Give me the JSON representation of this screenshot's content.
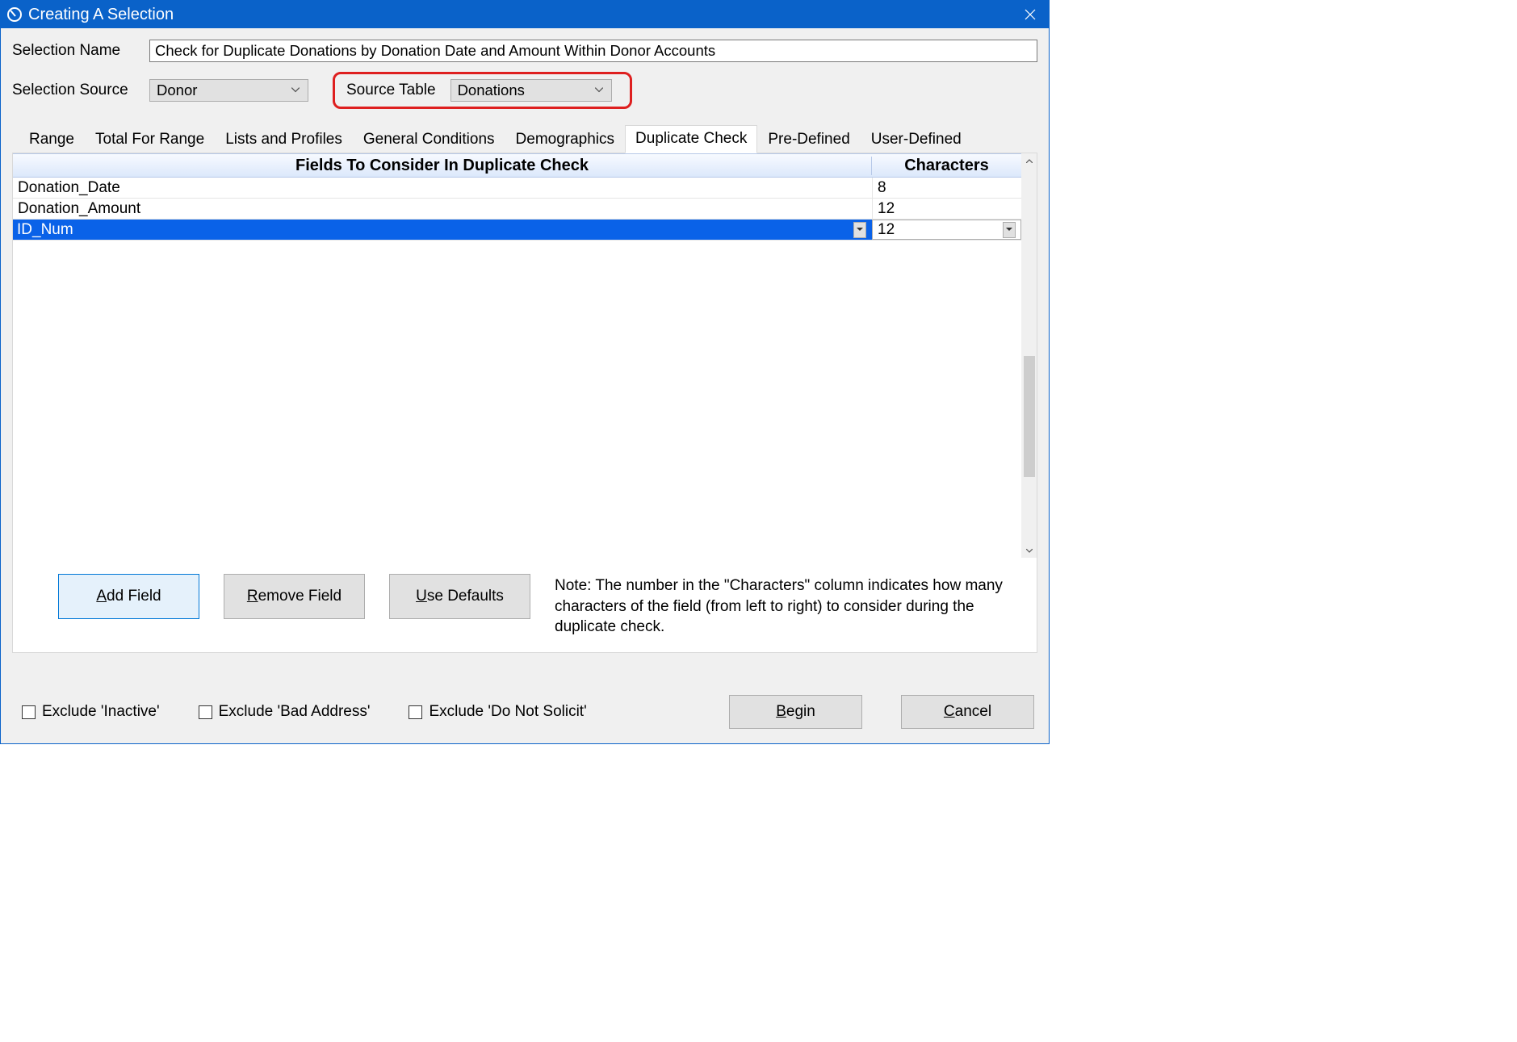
{
  "window": {
    "title": "Creating A Selection"
  },
  "fields": {
    "selection_name_label": "Selection Name",
    "selection_name_value": "Check for Duplicate Donations by Donation Date and Amount Within Donor Accounts",
    "selection_source_label": "Selection Source",
    "selection_source_value": "Donor",
    "source_table_label": "Source Table",
    "source_table_value": "Donations"
  },
  "tabs": [
    {
      "label": "Range"
    },
    {
      "label": "Total For Range"
    },
    {
      "label": "Lists and Profiles"
    },
    {
      "label": "General Conditions"
    },
    {
      "label": "Demographics"
    },
    {
      "label": "Duplicate Check"
    },
    {
      "label": "Pre-Defined"
    },
    {
      "label": "User-Defined"
    }
  ],
  "active_tab_index": 5,
  "grid": {
    "header_fields": "Fields To Consider In Duplicate Check",
    "header_chars": "Characters",
    "rows": [
      {
        "field": "Donation_Date",
        "chars": "8"
      },
      {
        "field": "Donation_Amount",
        "chars": "12"
      },
      {
        "field": "ID_Num",
        "chars": "12"
      }
    ],
    "editing_row_index": 2
  },
  "buttons": {
    "add_field_pre": "A",
    "add_field_rest": "dd Field",
    "remove_field_pre": "R",
    "remove_field_rest": "emove Field",
    "use_defaults_pre": "U",
    "use_defaults_rest": "se Defaults",
    "begin_pre": "B",
    "begin_rest": "egin",
    "cancel_pre": "C",
    "cancel_rest": "ancel"
  },
  "note_text": "Note:  The number in the \"Characters\" column indicates how many characters of the field (from left to right) to consider during the duplicate check.",
  "checkboxes": {
    "exclude_inactive": "Exclude 'Inactive'",
    "exclude_bad_address": "Exclude 'Bad Address'",
    "exclude_do_not_solicit": "Exclude 'Do Not Solicit'"
  }
}
